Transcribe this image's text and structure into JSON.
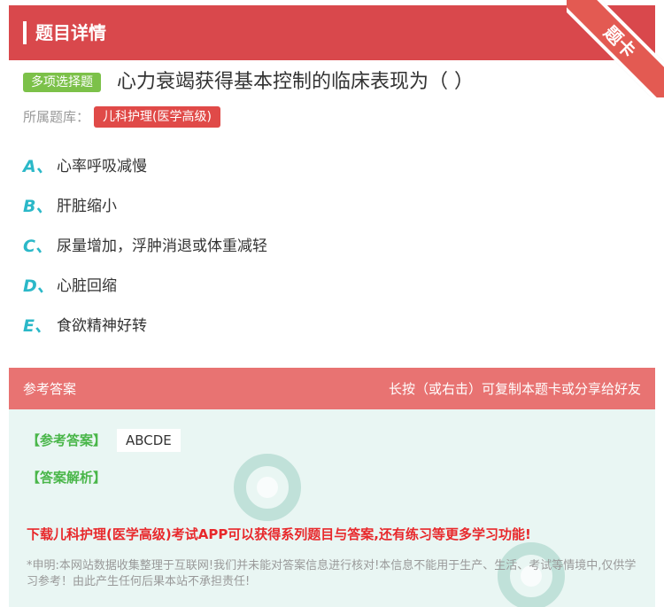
{
  "header": {
    "title": "题目详情",
    "corner_badge": "题卡"
  },
  "question": {
    "type_badge": "多项选择题",
    "text": "心力衰竭获得基本控制的临床表现为（ ）",
    "bank_label": "所属题库：",
    "bank_tag": "儿科护理(医学高级)"
  },
  "options": [
    {
      "letter": "A、",
      "text": "心率呼吸减慢"
    },
    {
      "letter": "B、",
      "text": "肝脏缩小"
    },
    {
      "letter": "C、",
      "text": "尿量增加，浮肿消退或体重减轻"
    },
    {
      "letter": "D、",
      "text": "心脏回缩"
    },
    {
      "letter": "E、",
      "text": "食欲精神好转"
    }
  ],
  "answer_section": {
    "title": "参考答案",
    "hint": "长按（或右击）可复制本题卡或分享给好友",
    "answer_label": "【参考答案】",
    "answer_value": "ABCDE",
    "analysis_label": "【答案解析】",
    "download_text": "下载儿科护理(医学高级)考试APP可以获得系列题目与答案,还有练习等更多学习功能!",
    "disclaimer": "*申明:本网站数据收集整理于互联网!我们并未能对答案信息进行核对!本信息不能用于生产、生活、考试等情境中,仅供学习参考！由此产生任何后果本站不承担责任!"
  },
  "colors": {
    "header_bg": "#d9484c",
    "badge_green": "#7cc149",
    "tag_red": "#e04a48",
    "option_letter": "#2bb8c8",
    "answer_header_bg": "#e87372",
    "answer_body_bg": "#e9f6f3",
    "answer_label_green": "#49b649",
    "download_red": "#e8282b"
  }
}
